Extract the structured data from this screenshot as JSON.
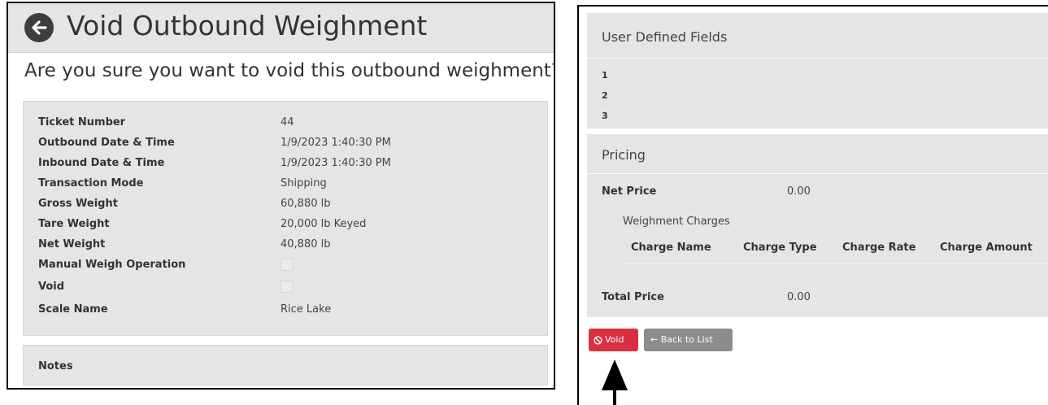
{
  "left": {
    "title": "Void Outbound Weighment",
    "question": "Are you sure you want to void this outbound weighment?",
    "details": [
      {
        "label": "Ticket Number",
        "value": "44"
      },
      {
        "label": "Outbound Date & Time",
        "value": "1/9/2023 1:40:30 PM"
      },
      {
        "label": "Inbound Date & Time",
        "value": "1/9/2023 1:40:30 PM"
      },
      {
        "label": "Transaction Mode",
        "value": "Shipping"
      },
      {
        "label": "Gross Weight",
        "value": "60,880 lb"
      },
      {
        "label": "Tare Weight",
        "value": "20,000 lb Keyed"
      },
      {
        "label": "Net Weight",
        "value": "40,880 lb"
      },
      {
        "label": "Manual Weigh Operation",
        "checked": false
      },
      {
        "label": "Void",
        "checked": false
      },
      {
        "label": "Scale Name",
        "value": "Rice Lake"
      }
    ],
    "notes_label": "Notes"
  },
  "right": {
    "udf_header": "User Defined Fields",
    "udf_items": [
      "1",
      "2",
      "3"
    ],
    "pricing_header": "Pricing",
    "net_price_label": "Net Price",
    "net_price_value": "0.00",
    "charges_label": "Weighment Charges",
    "charge_columns": [
      "Charge Name",
      "Charge Type",
      "Charge Rate",
      "Charge Amount"
    ],
    "total_price_label": "Total Price",
    "total_price_value": "0.00",
    "void_button": "Void",
    "back_button": "← Back to List"
  },
  "colors": {
    "panel_bg": "#e5e5e5",
    "void_button": "#d9303f",
    "back_button": "#8c8c8c",
    "icon_dark": "#3d3d3d"
  },
  "icons": {
    "back": "arrow-circle-left-icon",
    "void": "ban-icon"
  }
}
